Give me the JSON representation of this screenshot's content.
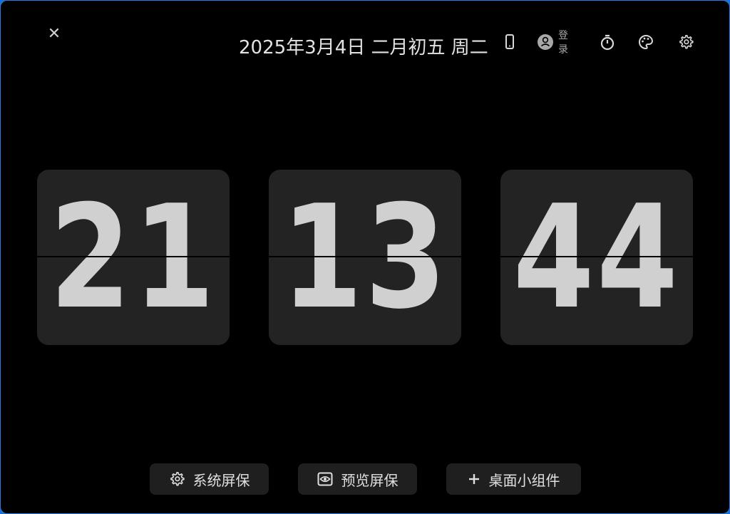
{
  "window": {
    "close_glyph": "✕",
    "date_text": "2025年3月4日 二月初五 周二"
  },
  "toolbar": {
    "login_label": "登录",
    "icons": [
      "phone-icon",
      "user-avatar-icon",
      "timer-icon",
      "palette-icon",
      "gear-icon"
    ]
  },
  "clock": {
    "hours": "21",
    "minutes": "13",
    "seconds": "44"
  },
  "actions": {
    "screensaver_label": "系统屏保",
    "preview_label": "预览屏保",
    "widget_label": "桌面小组件"
  },
  "colors": {
    "background": "#000000",
    "card": "#232323",
    "digit": "#d0d0d0",
    "button_bg": "#1f1f1f",
    "window_border": "#1a6fd6"
  }
}
